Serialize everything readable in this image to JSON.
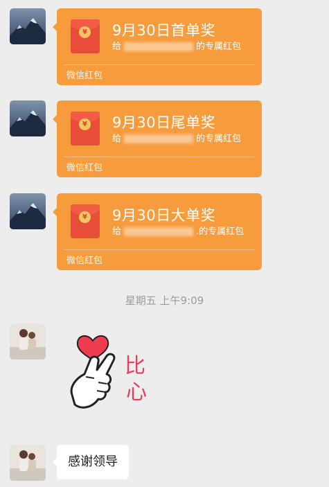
{
  "messages": [
    {
      "title": "9月30日首单奖",
      "sub_prefix": "给",
      "sub_suffix": "的专属红包",
      "footer": "微信红包"
    },
    {
      "title": "9月30日尾单奖",
      "sub_prefix": "给",
      "sub_suffix": "的专属红包",
      "footer": "微信红包"
    },
    {
      "title": "9月30日大单奖",
      "sub_prefix": "给",
      "sub_suffix": ".的专属红包",
      "footer": "微信红包"
    }
  ],
  "timestamp": "星期五 上午9:09",
  "sticker": {
    "text_top": "比",
    "text_bottom": "心"
  },
  "text_message": "感谢领导",
  "colors": {
    "red_packet": "#f79c3d",
    "envelope": "#e84d3a",
    "background": "#ededed",
    "sticker_text": "#e53e5a"
  },
  "icons": {
    "envelope": "red-envelope-icon",
    "coin": "yuan-coin-icon",
    "sticker": "finger-heart-sticker"
  }
}
